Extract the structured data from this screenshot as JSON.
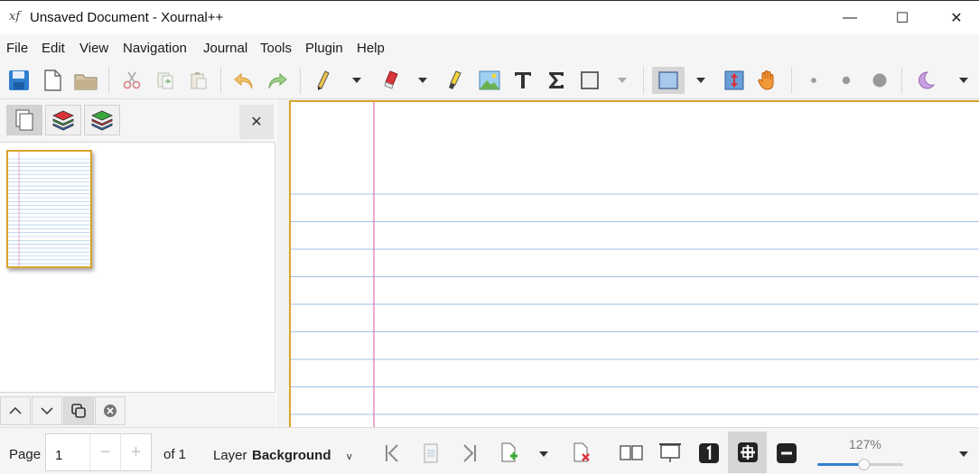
{
  "window": {
    "title": "Unsaved Document - Xournal++",
    "app_icon_text": "xf",
    "min_glyph": "—",
    "max_glyph": "☐",
    "close_glyph": "✕"
  },
  "menu": {
    "items": [
      "File",
      "Edit",
      "View",
      "Navigation",
      "Journal",
      "Tools",
      "Plugin",
      "Help"
    ]
  },
  "sidebar": {
    "close_glyph": "✕"
  },
  "statusbar": {
    "page_label": "Page",
    "page_value": "1",
    "page_minus": "−",
    "page_plus": "+",
    "of_label": "of 1",
    "layer_label": "Layer",
    "layer_value": "Background",
    "layer_chevron": "v",
    "zoom_label": "127%",
    "zoom_fraction": 0.55
  },
  "colors": {
    "page_border": "#d9a32c",
    "rule_line": "#9ec3e6",
    "margin_line": "#e070b8",
    "selection_fill": "#a8c8ec"
  }
}
